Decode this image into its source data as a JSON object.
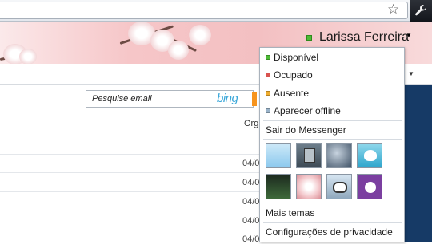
{
  "browser": {
    "star_icon": "star-icon",
    "wrench_icon": "wrench-icon"
  },
  "header": {
    "user_name": "Larissa Ferreira",
    "status_color": "#4dbb35"
  },
  "search": {
    "placeholder": "Pesquise email",
    "engine_logo": "bing"
  },
  "list": {
    "column_header": "Org",
    "dates": [
      "04/0",
      "04/0",
      "04/0",
      "04/0",
      "04/0"
    ]
  },
  "status_menu": {
    "statuses": [
      {
        "label": "Disponível",
        "color": "#4dbb35"
      },
      {
        "label": "Ocupado",
        "color": "#d9534f"
      },
      {
        "label": "Ausente",
        "color": "#f0ad2e"
      },
      {
        "label": "Aparecer offline",
        "color": "#9ab3c9"
      }
    ],
    "sign_out": "Sair do Messenger",
    "more_themes": "Mais temas",
    "privacy_settings": "Configurações de privacidade"
  }
}
